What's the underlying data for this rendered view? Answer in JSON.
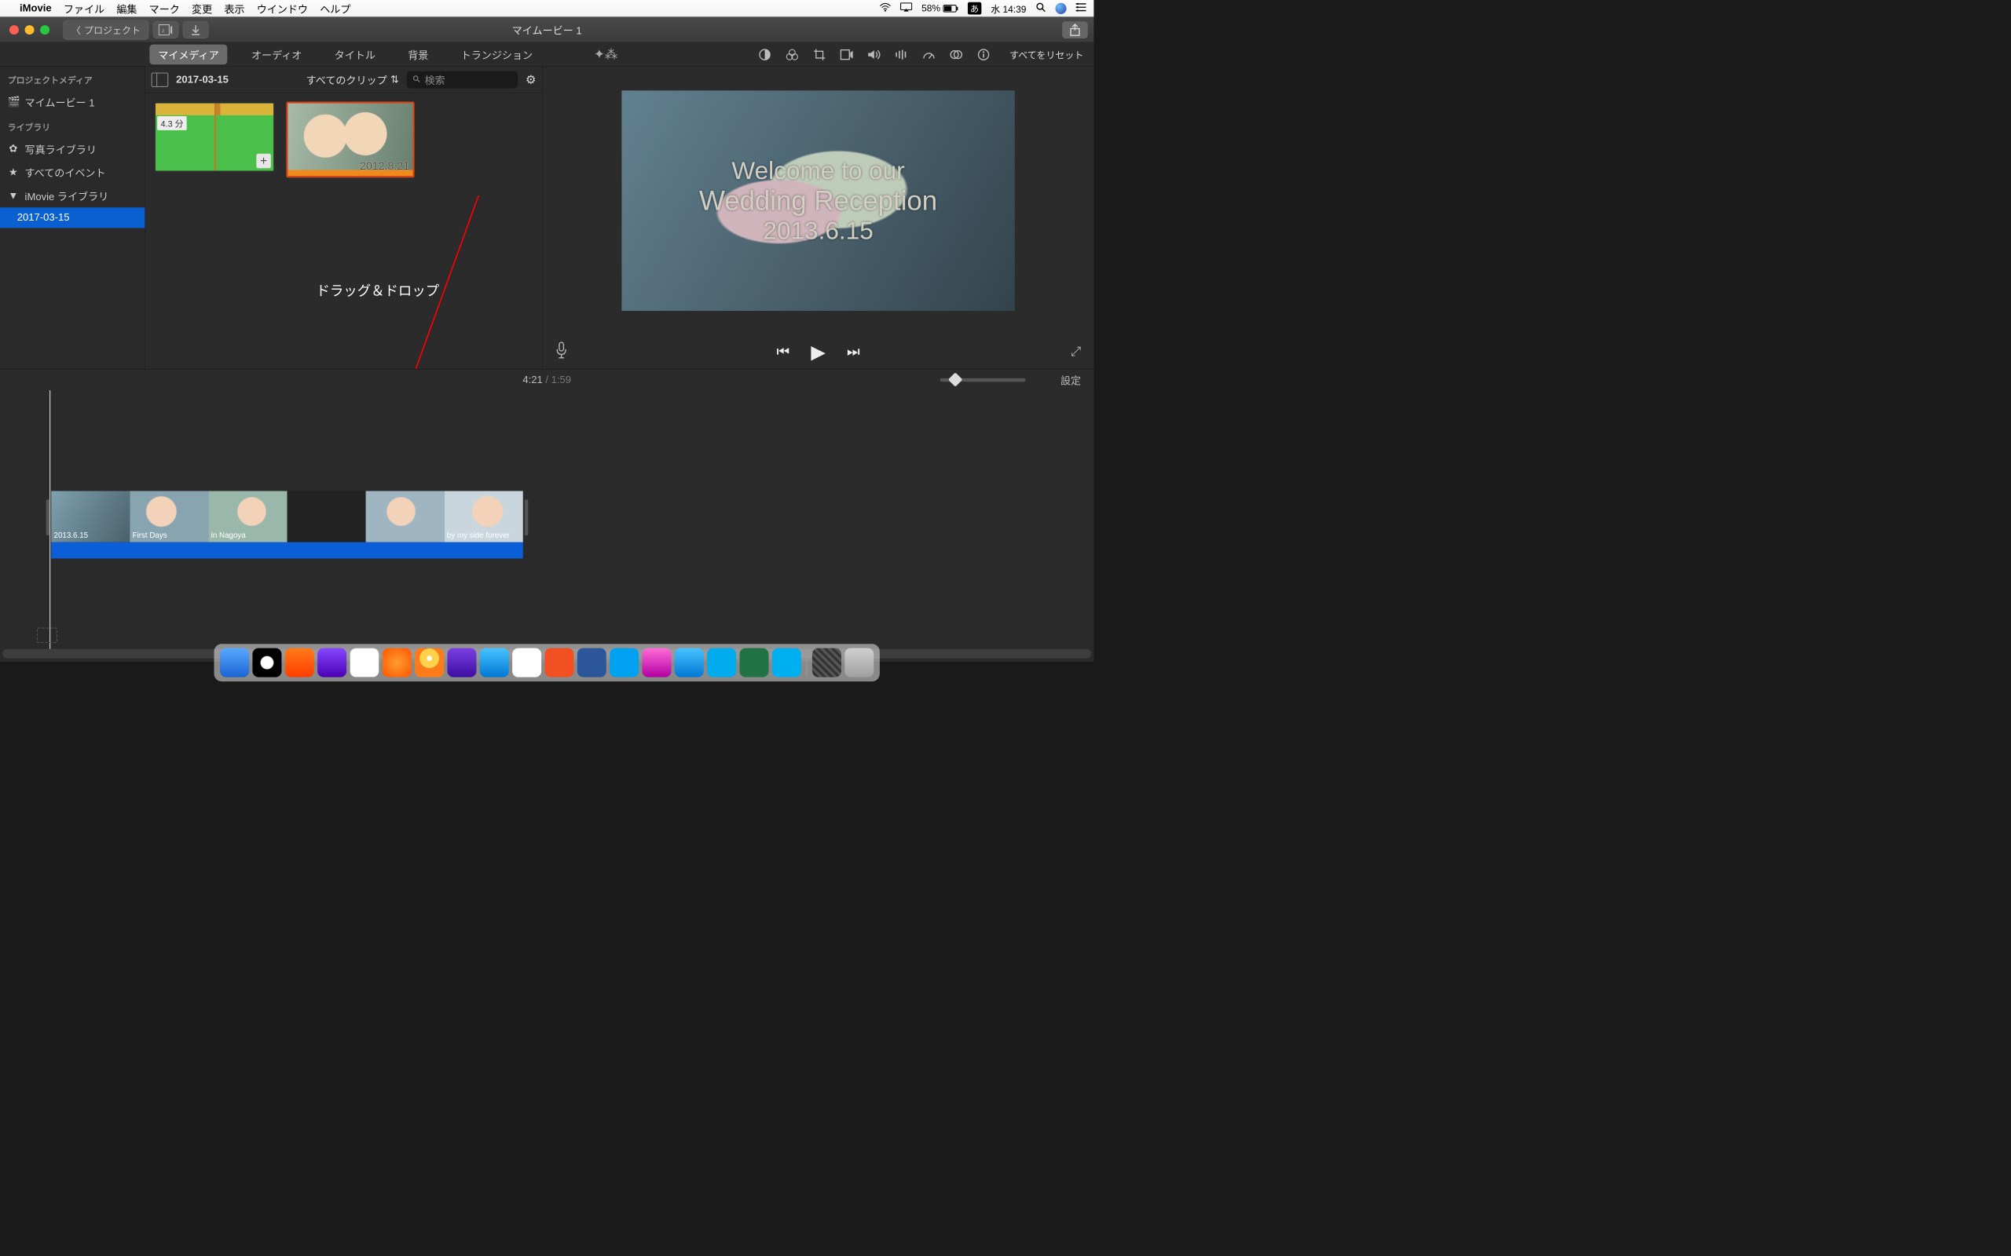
{
  "menubar": {
    "app": "iMovie",
    "items": [
      "ファイル",
      "編集",
      "マーク",
      "変更",
      "表示",
      "ウインドウ",
      "ヘルプ"
    ],
    "battery": "58%",
    "ime": "あ",
    "clock": "水 14:39"
  },
  "titlebar": {
    "back_label": "プロジェクト",
    "title": "マイムービー 1"
  },
  "tabs": {
    "items": [
      "マイメディア",
      "オーディオ",
      "タイトル",
      "背景",
      "トランジション"
    ],
    "active_index": 0,
    "reset": "すべてをリセット"
  },
  "sidebar": {
    "project_media_head": "プロジェクトメディア",
    "project_name": "マイムービー 1",
    "library_head": "ライブラリ",
    "photo_library": "写真ライブラリ",
    "all_events": "すべてのイベント",
    "imovie_library": "iMovie ライブラリ",
    "event_date": "2017-03-15"
  },
  "browser_bar": {
    "date": "2017-03-15",
    "clip_filter": "すべてのクリップ",
    "search_placeholder": "検索"
  },
  "clips": {
    "project_duration": "4.3 分",
    "video_overlay_date": "2012.8.21"
  },
  "annotation": "ドラッグ＆ドロップ",
  "preview": {
    "line1": "Welcome to our",
    "line2": "Wedding Reception",
    "line3": "2013.6.15"
  },
  "timebar": {
    "current": "4:21",
    "total": "1:59",
    "settings": "設定"
  },
  "timeline_clips": [
    "2013.6.15",
    "First Days",
    "in Nagoya",
    "",
    "",
    "by my side forever"
  ]
}
